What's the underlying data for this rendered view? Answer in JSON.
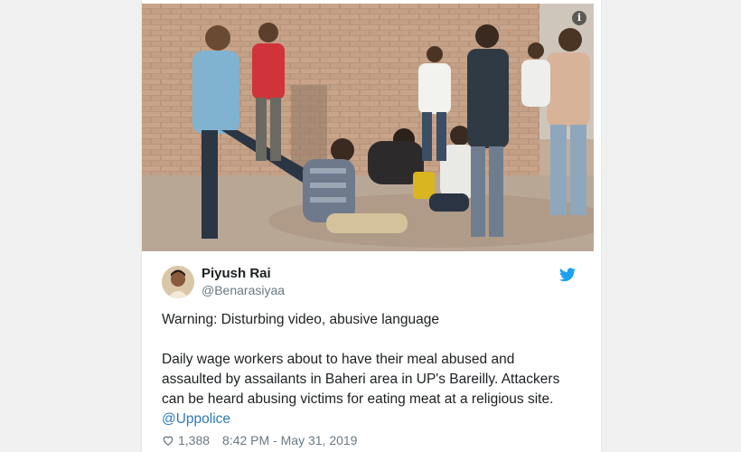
{
  "media": {
    "info_icon": "info-icon",
    "image_kind": "photo"
  },
  "tweet": {
    "author_name": "Piyush Rai",
    "author_handle": "@Benarasiyaa",
    "warning_text": "Warning: Disturbing video, abusive language",
    "main_text": "Daily wage workers about to have their meal abused and assaulted by assailants in Baheri area in UP's Bareilly. Attackers can be heard abusing victims for eating meat at a religious site.",
    "mention": "@Uppolice",
    "like_count": "1,388",
    "timestamp": "8:42 PM - May 31, 2019",
    "brand_icon": "twitter-bird-icon",
    "like_icon": "heart-icon"
  },
  "colors": {
    "brand": "#1da1f2",
    "link": "#2b7bb9",
    "text": "#1c2022",
    "muted": "#697882"
  }
}
